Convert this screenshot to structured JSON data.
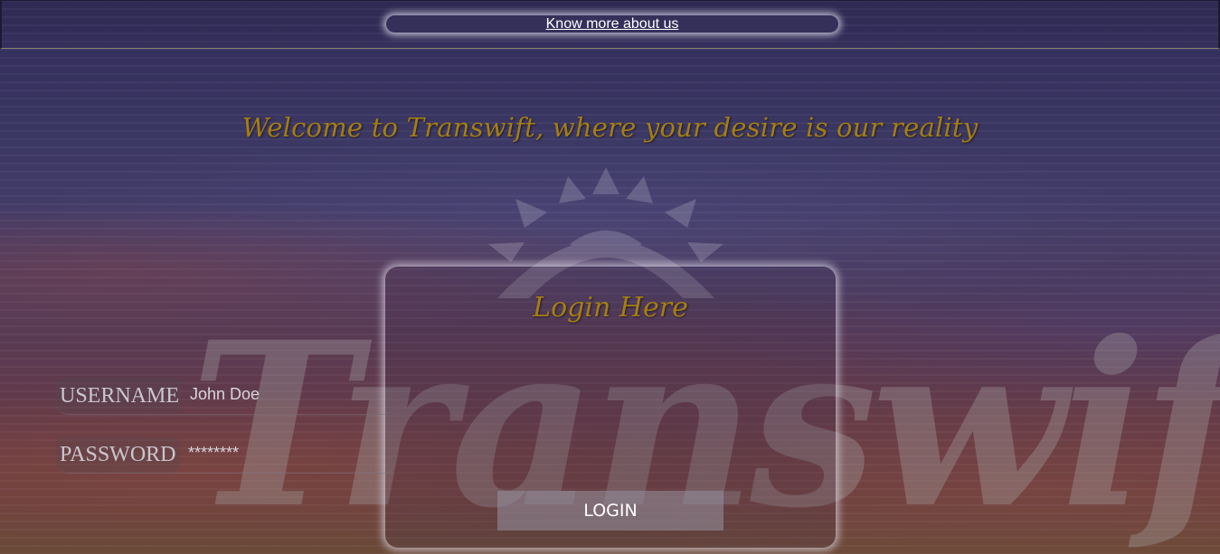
{
  "header": {
    "about_link": "Know more about us"
  },
  "welcome": {
    "heading": "Welcome to Transwift, where your desire is our reality"
  },
  "logo": {
    "wordmark": "Transwift"
  },
  "login": {
    "title": "Login Here",
    "username_label": "USERNAME",
    "username_value": "John Doe",
    "password_label": "PASSWORD",
    "password_value": "********",
    "button_label": "LOGIN"
  },
  "colors": {
    "heading_gold": "#a57e12",
    "background_top": "#2e2a52",
    "background_bottom": "#6b4a38"
  }
}
